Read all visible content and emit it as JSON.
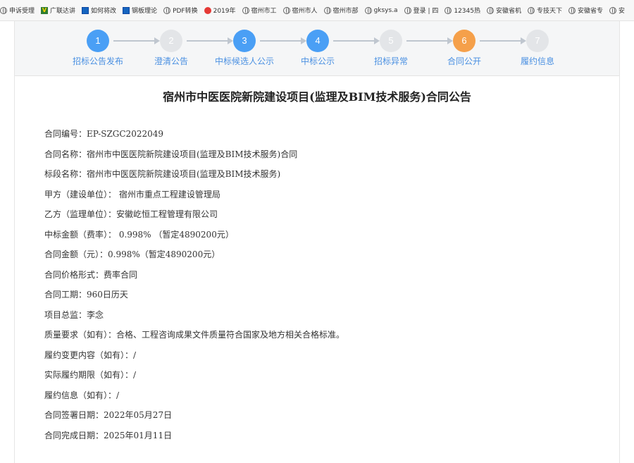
{
  "bookmarks": [
    {
      "label": "申诉受理",
      "icon": "globe-icon"
    },
    {
      "label": "广联达讲",
      "icon": "v-logo-icon"
    },
    {
      "label": "如何将改",
      "icon": "square-logo-icon"
    },
    {
      "label": "钢板理论",
      "icon": "square-logo-icon"
    },
    {
      "label": "PDF转换",
      "icon": "globe-icon"
    },
    {
      "label": "2019年",
      "icon": "red-logo-icon"
    },
    {
      "label": "宿州市工",
      "icon": "globe-icon"
    },
    {
      "label": "宿州市人",
      "icon": "globe-icon"
    },
    {
      "label": "宿州市部",
      "icon": "globe-icon"
    },
    {
      "label": "gksys.a",
      "icon": "globe-icon"
    },
    {
      "label": "登录 | 四",
      "icon": "globe-icon"
    },
    {
      "label": "12345热",
      "icon": "globe-icon"
    },
    {
      "label": "安徽省机",
      "icon": "globe-icon"
    },
    {
      "label": "专技天下",
      "icon": "globe-icon"
    },
    {
      "label": "安徽省专",
      "icon": "globe-icon"
    },
    {
      "label": "安",
      "icon": "globe-icon"
    }
  ],
  "steps": [
    {
      "num": "1",
      "label": "招标公告发布",
      "state": "blue"
    },
    {
      "num": "2",
      "label": "澄清公告",
      "state": "grey"
    },
    {
      "num": "3",
      "label": "中标候选人公示",
      "state": "blue"
    },
    {
      "num": "4",
      "label": "中标公示",
      "state": "blue"
    },
    {
      "num": "5",
      "label": "招标异常",
      "state": "grey"
    },
    {
      "num": "6",
      "label": "合同公开",
      "state": "orange"
    },
    {
      "num": "7",
      "label": "履约信息",
      "state": "grey"
    }
  ],
  "colors": {
    "step_blue": "#4a9ff5",
    "step_orange": "#f5a04a",
    "step_grey": "#e3e5e8",
    "link_blue": "#4a90e2"
  },
  "title": "宿州市中医医院新院建设项目(监理及BIM技术服务)合同公告",
  "fields": [
    "合同编号：EP-SZGC2022049",
    "合同名称：宿州市中医医院新院建设项目(监理及BIM技术服务)合同",
    "标段名称：宿州市中医医院新院建设项目(监理及BIM技术服务)",
    "甲方（建设单位）：  宿州市重点工程建设管理局",
    "乙方（监理单位）：安徽屹恒工程管理有限公司",
    "中标金额（费率）：  0.998%  （暂定4890200元）",
    "合同金额（元）：0.998%（暂定4890200元）",
    "合同价格形式：费率合同",
    "合同工期：960日历天",
    "项目总监：李念",
    "质量要求（如有）：合格、工程咨询成果文件质量符合国家及地方相关合格标准。",
    "履约变更内容（如有）：/",
    "实际履约期限（如有）：/",
    "履约信息（如有）：/",
    "合同签署日期：2022年05月27日",
    "合同完成日期：2025年01月11日"
  ]
}
